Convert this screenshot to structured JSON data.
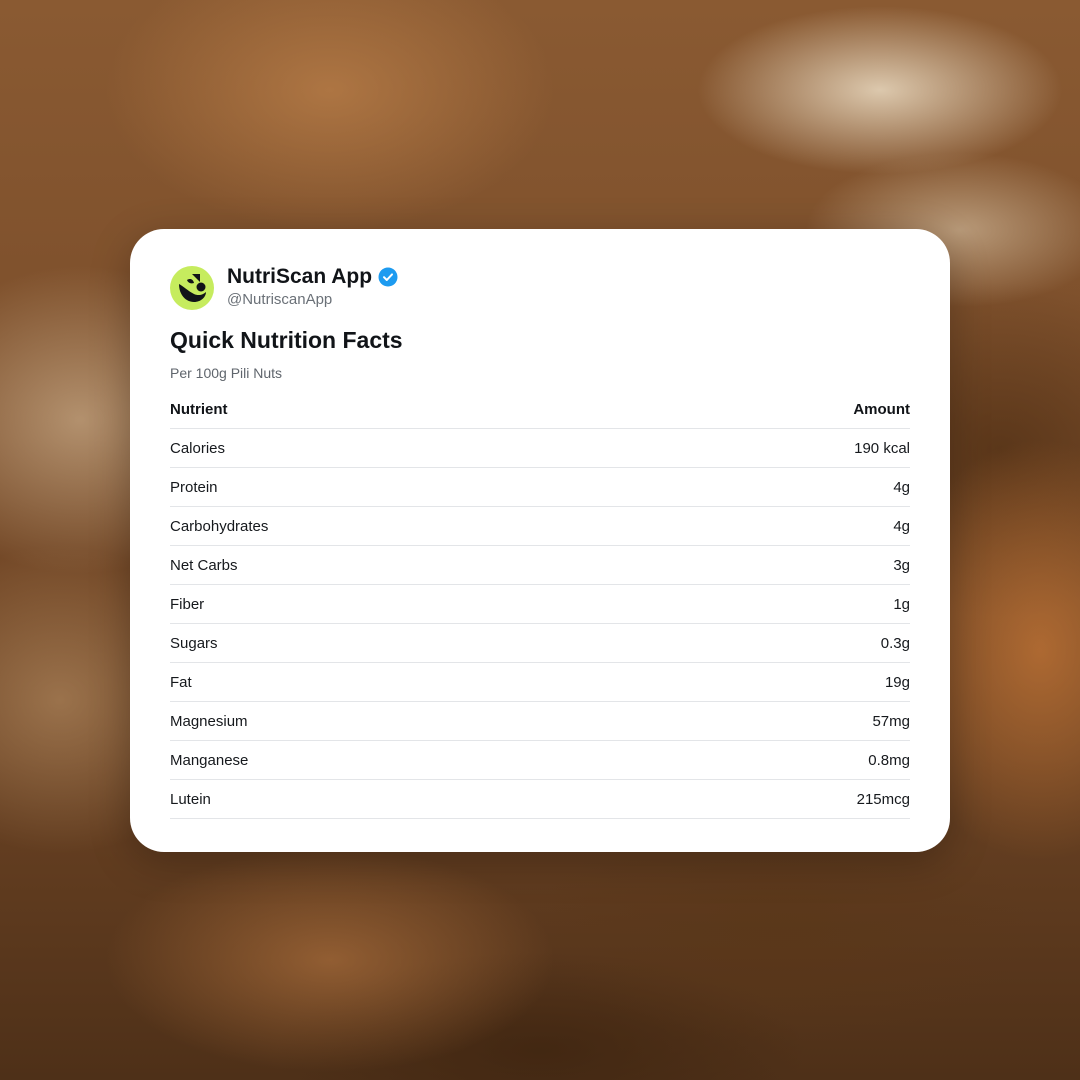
{
  "profile": {
    "name": "NutriScan App",
    "handle": "@NutriscanApp",
    "verified": true,
    "avatar_icon": "leaf-logo-icon",
    "avatar_color": "#c6ec5e",
    "verified_color": "#1d9bf0"
  },
  "card": {
    "title": "Quick Nutrition Facts",
    "subtitle": "Per 100g Pili Nuts"
  },
  "table": {
    "headers": [
      "Nutrient",
      "Amount"
    ],
    "rows": [
      [
        "Calories",
        "190 kcal"
      ],
      [
        "Protein",
        "4g"
      ],
      [
        "Carbohydrates",
        "4g"
      ],
      [
        "Net Carbs",
        "3g"
      ],
      [
        "Fiber",
        "1g"
      ],
      [
        "Sugars",
        "0.3g"
      ],
      [
        "Fat",
        "19g"
      ],
      [
        "Magnesium",
        "57mg"
      ],
      [
        "Manganese",
        "0.8mg"
      ],
      [
        "Lutein",
        "215mcg"
      ]
    ]
  }
}
